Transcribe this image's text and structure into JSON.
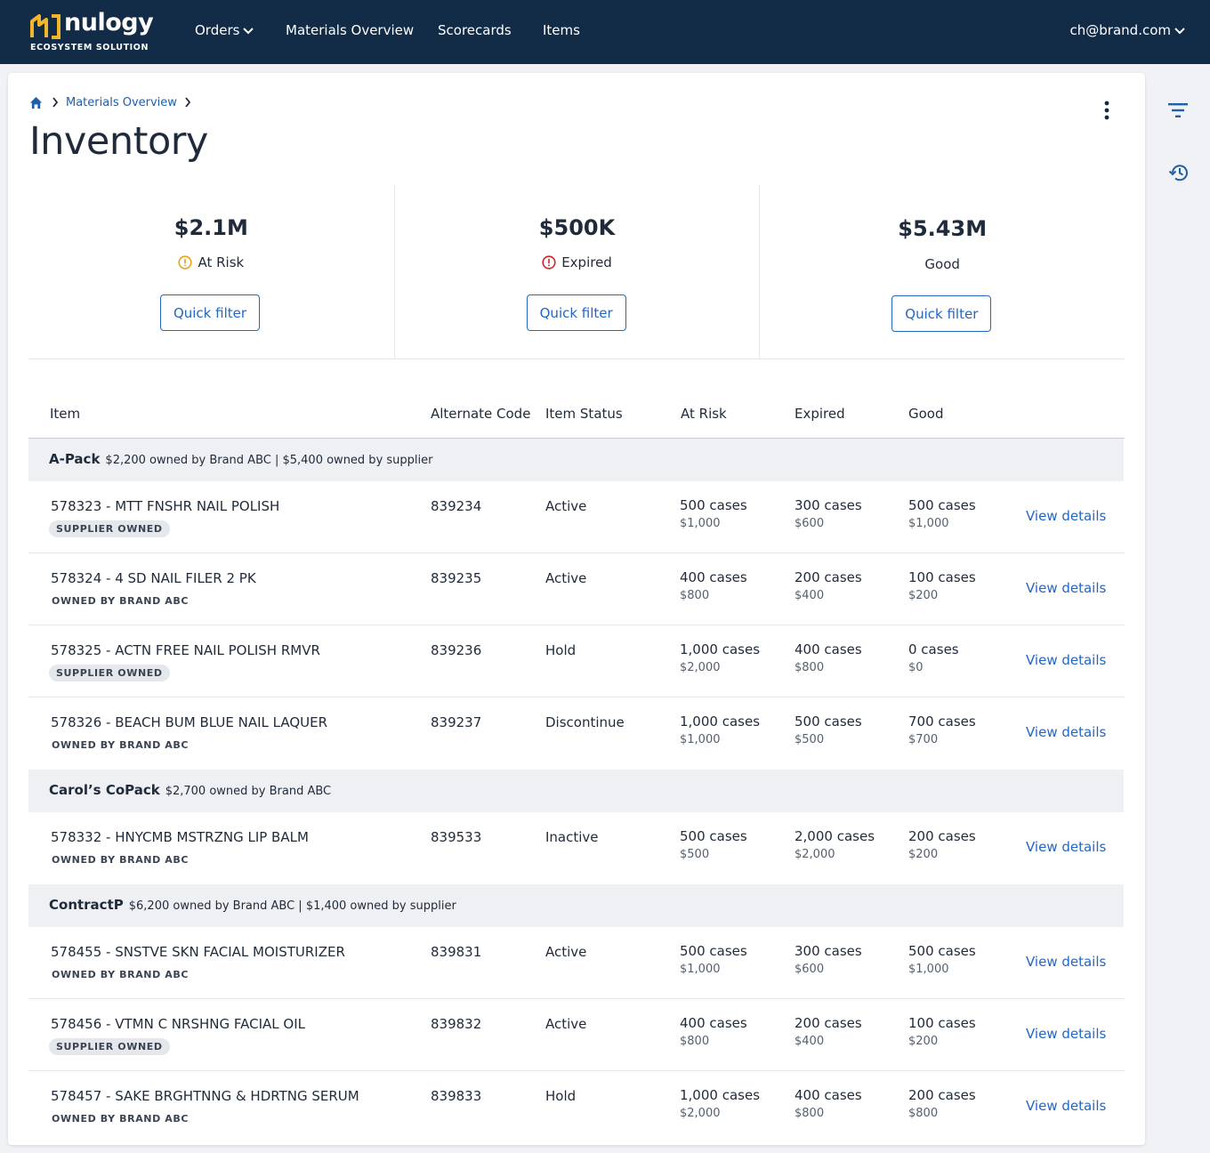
{
  "nav": {
    "logo_word": "nulogy",
    "logo_sub": "ECOSYSTEM SOLUTION",
    "links": [
      "Orders",
      "Materials Overview",
      "Scorecards",
      "Items"
    ],
    "user": "ch@brand.com"
  },
  "breadcrumb": {
    "items": [
      "Materials Overview"
    ]
  },
  "page": {
    "title": "Inventory"
  },
  "summary": [
    {
      "value": "$2.1M",
      "label": "At Risk",
      "icon": "warning-circle-icon",
      "icon_color": "#e8a317",
      "button": "Quick filter"
    },
    {
      "value": "$500K",
      "label": "Expired",
      "icon": "error-circle-icon",
      "icon_color": "#d0242c",
      "button": "Quick filter"
    },
    {
      "value": "$5.43M",
      "label": "Good",
      "icon": "",
      "button": "Quick filter"
    }
  ],
  "table": {
    "headers": [
      "Item",
      "Alternate Code",
      "Item Status",
      "At Risk",
      "Expired",
      "Good"
    ],
    "view_label": "View details",
    "groups": [
      {
        "name": "A-Pack",
        "meta": "$2,200 owned by Brand ABC | $5,400 owned by supplier",
        "rows": [
          {
            "item": "578323 - MTT FNSHR NAIL POLISH",
            "badge": "SUPPLIER OWNED",
            "alt": "839234",
            "status": "Active",
            "risk_cases": "500 cases",
            "risk_money": "$1,000",
            "exp_cases": "300 cases",
            "exp_money": "$600",
            "good_cases": "500 cases",
            "good_money": "$1,000"
          },
          {
            "item": "578324 - 4 SD NAIL FILER 2 PK",
            "badge": "OWNED BY BRAND ABC",
            "alt": "839235",
            "status": "Active",
            "risk_cases": "400 cases",
            "risk_money": "$800",
            "exp_cases": "200 cases",
            "exp_money": "$400",
            "good_cases": "100 cases",
            "good_money": "$200"
          },
          {
            "item": "578325 - ACTN FREE NAIL POLISH RMVR",
            "badge": "SUPPLIER OWNED",
            "alt": "839236",
            "status": "Hold",
            "risk_cases": "1,000 cases",
            "risk_money": "$2,000",
            "exp_cases": "400 cases",
            "exp_money": "$800",
            "good_cases": "0 cases",
            "good_money": "$0"
          },
          {
            "item": "578326 - BEACH BUM BLUE NAIL LAQUER",
            "badge": "OWNED BY BRAND ABC",
            "alt": "839237",
            "status": "Discontinue",
            "risk_cases": "1,000 cases",
            "risk_money": "$1,000",
            "exp_cases": "500 cases",
            "exp_money": "$500",
            "good_cases": "700 cases",
            "good_money": "$700"
          }
        ]
      },
      {
        "name": "Carol’s CoPack",
        "meta": "$2,700 owned by Brand ABC",
        "rows": [
          {
            "item": "578332 - HNYCMB MSTRZNG LIP BALM",
            "badge": "OWNED BY BRAND ABC",
            "alt": "839533",
            "status": "Inactive",
            "risk_cases": "500 cases",
            "risk_money": "$500",
            "exp_cases": "2,000 cases",
            "exp_money": "$2,000",
            "good_cases": "200 cases",
            "good_money": "$200"
          }
        ]
      },
      {
        "name": "ContractP",
        "meta": "$6,200 owned by Brand ABC | $1,400 owned by supplier",
        "rows": [
          {
            "item": "578455 - SNSTVE SKN FACIAL MOISTURIZER",
            "badge": "OWNED BY BRAND ABC",
            "alt": "839831",
            "status": "Active",
            "risk_cases": "500 cases",
            "risk_money": "$1,000",
            "exp_cases": "300 cases",
            "exp_money": "$600",
            "good_cases": "500 cases",
            "good_money": "$1,000"
          },
          {
            "item": "578456 - VTMN C NRSHNG FACIAL OIL",
            "badge": "SUPPLIER OWNED",
            "alt": "839832",
            "status": "Active",
            "risk_cases": "400 cases",
            "risk_money": "$800",
            "exp_cases": "200 cases",
            "exp_money": "$400",
            "good_cases": "100 cases",
            "good_money": "$200"
          },
          {
            "item": "578457 - SAKE BRGHTNNG & HDRTNG SERUM",
            "badge": "OWNED BY BRAND ABC",
            "alt": "839833",
            "status": "Hold",
            "risk_cases": "1,000 cases",
            "risk_money": "$2,000",
            "exp_cases": "400 cases",
            "exp_money": "$800",
            "good_cases": "200 cases",
            "good_money": "$800"
          }
        ]
      }
    ]
  },
  "rail": {
    "icons": [
      "filter-icon",
      "history-icon"
    ]
  },
  "colors": {
    "nav_bg": "#122b47",
    "accent": "#2267c3",
    "logo_yellow": "#f2b62b"
  }
}
